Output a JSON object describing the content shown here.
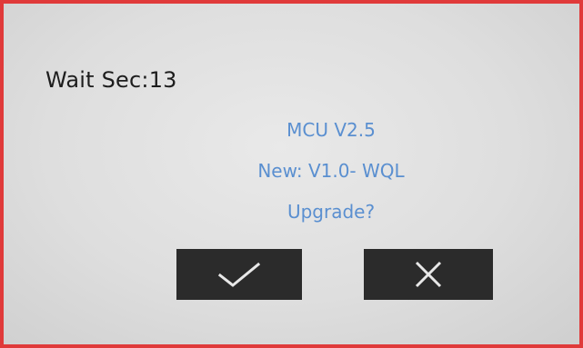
{
  "dialog": {
    "wait_text": "Wait Sec:13",
    "mcu_version": "MCU V2.5",
    "new_version": "New: V1.0- WQL",
    "prompt": "Upgrade?"
  },
  "buttons": {
    "confirm_icon": "checkmark-icon",
    "cancel_icon": "x-icon"
  },
  "colors": {
    "frame_border": "#e03a3a",
    "screen_background": "#e4e4e4",
    "info_text": "#5a8fd0",
    "wait_text": "#1d1d1d",
    "button_fill": "#2b2b2b",
    "button_icon": "#e8e8e8"
  }
}
